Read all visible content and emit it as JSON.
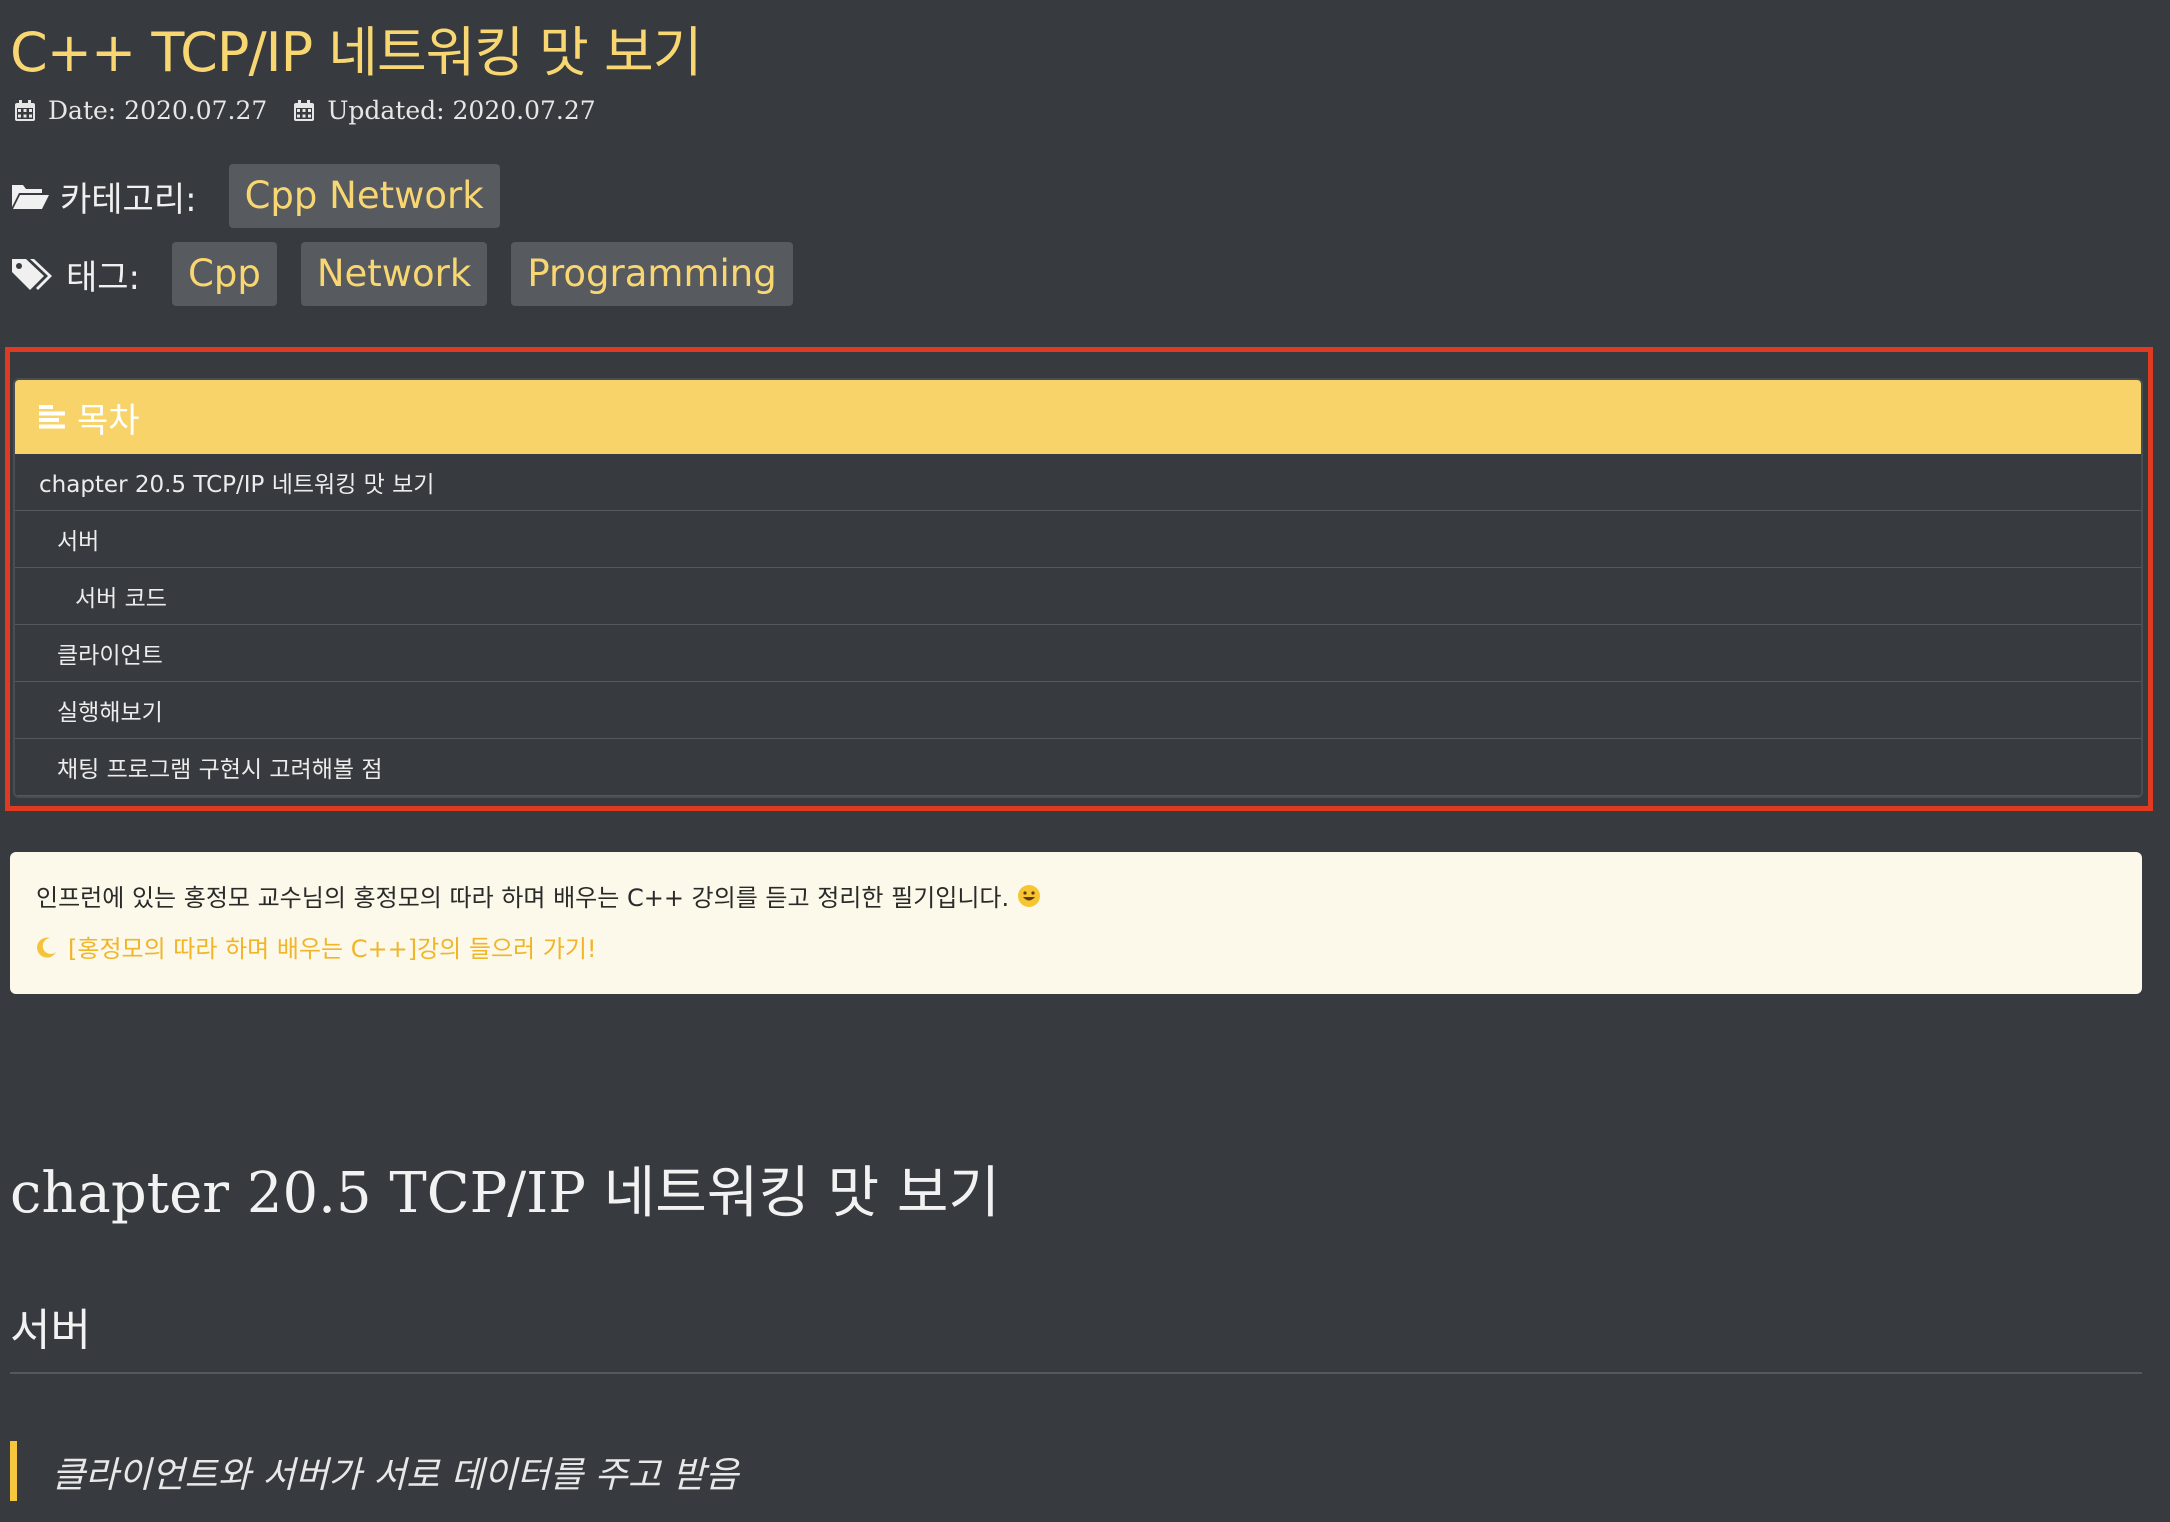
{
  "post": {
    "title": "C++ TCP/IP 네트워킹 맛 보기",
    "date": "Date: 2020.07.27",
    "updated": "Updated: 2020.07.27",
    "category_label": "카테고리:",
    "categories": [
      "Cpp Network"
    ],
    "tag_label": "태그:",
    "tags": [
      "Cpp",
      "Network",
      "Programming"
    ]
  },
  "toc": {
    "title": "목차",
    "items": [
      {
        "label": "chapter 20.5 TCP/IP 네트워킹 맛 보기",
        "level": 1
      },
      {
        "label": "서버",
        "level": 2
      },
      {
        "label": "서버 코드",
        "level": 3
      },
      {
        "label": "클라이언트",
        "level": 2
      },
      {
        "label": "실행해보기",
        "level": 2
      },
      {
        "label": "채팅 프로그램 구현시 고려해볼 점",
        "level": 2
      }
    ]
  },
  "notice": {
    "text": "인프런에 있는 홍정모 교수님의 홍정모의 따라 하며 배우는 C++ 강의를 듣고 정리한 필기입니다.",
    "link": "[홍정모의 따라 하며 배우는 C++]강의 들으러 가기!"
  },
  "content": {
    "h1": "chapter 20.5 TCP/IP 네트워킹 맛 보기",
    "h2": "서버",
    "blockquote": "클라이언트와 서버가 서로 데이터를 주고 받음"
  },
  "colors": {
    "background": "#373a3e",
    "accent": "#f8d672",
    "toc_header": "#f8d36a",
    "highlight_border": "#e03a22",
    "notice_bg": "#fcf8ea",
    "link": "#f1b52a"
  }
}
